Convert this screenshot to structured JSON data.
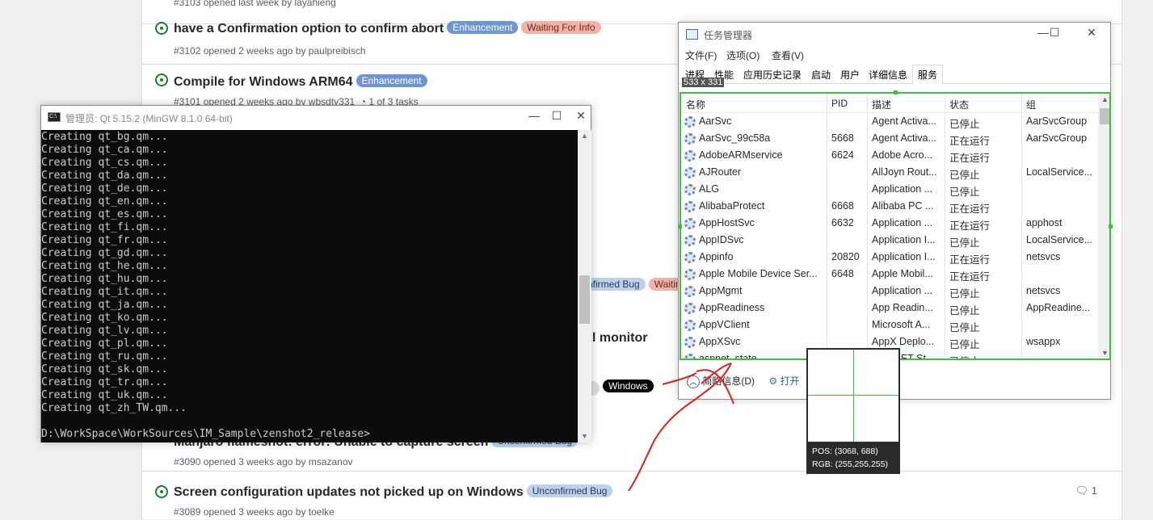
{
  "issues": [
    {
      "title": "",
      "meta": "#3103 opened last week by layahieng",
      "labels": []
    },
    {
      "title": "have a Confirmation option to confirm abort",
      "meta": "#3102 opened 2 weeks ago by paulpreibisch",
      "labels": [
        "Enhancement",
        "Waiting For Info"
      ]
    },
    {
      "title": "Compile for Windows ARM64",
      "meta": "#3101 opened 2 weeks ago by wbsdty331",
      "labels": [
        "Enhancement"
      ],
      "tasks": "1 of 3 tasks"
    },
    {
      "frag_labels": [
        "nfirmed Bug",
        "Waitin"
      ]
    },
    {
      "frag_title": "l monitor"
    },
    {
      "frag_label": "Windows"
    },
    {
      "title": "Manjaro flameshot: error: Unable to capture screen",
      "meta": "#3090 opened 3 weeks ago by msazanov",
      "labels": [
        "Unconfirmed Bug"
      ]
    },
    {
      "title": "Screen configuration updates not picked up on Windows",
      "meta": "#3089 opened 3 weeks ago by toelke",
      "labels": [
        "Unconfirmed Bug"
      ],
      "comments": "1"
    }
  ],
  "console": {
    "title": "管理员: Qt 5.15.2 (MinGW 8.1.0 64-bit)",
    "lines": [
      "Creating qt_bg.qm...",
      "Creating qt_ca.qm...",
      "Creating qt_cs.qm...",
      "Creating qt_da.qm...",
      "Creating qt_de.qm...",
      "Creating qt_en.qm...",
      "Creating qt_es.qm...",
      "Creating qt_fi.qm...",
      "Creating qt_fr.qm...",
      "Creating qt_gd.qm...",
      "Creating qt_he.qm...",
      "Creating qt_hu.qm...",
      "Creating qt_it.qm...",
      "Creating qt_ja.qm...",
      "Creating qt_ko.qm...",
      "Creating qt_lv.qm...",
      "Creating qt_pl.qm...",
      "Creating qt_ru.qm...",
      "Creating qt_sk.qm...",
      "Creating qt_tr.qm...",
      "Creating qt_uk.qm...",
      "Creating qt_zh_TW.qm...",
      "",
      "D:\\WorkSpace\\WorkSources\\IM_Sample\\zenshot2_release>"
    ]
  },
  "taskmgr": {
    "title": "任务管理器",
    "menu": [
      "文件(F)",
      "选项(O)",
      "查看(V)"
    ],
    "tabs": [
      "进程",
      "性能",
      "应用历史记录",
      "启动",
      "用户",
      "详细信息",
      "服务"
    ],
    "active_tab": "服务",
    "selection_size": "533 x 331",
    "columns": [
      "名称",
      "PID",
      "描述",
      "状态",
      "组"
    ],
    "rows": [
      [
        "AarSvc",
        "",
        "Agent Activa...",
        "已停止",
        "AarSvcGroup"
      ],
      [
        "AarSvc_99c58a",
        "5668",
        "Agent Activa...",
        "正在运行",
        "AarSvcGroup"
      ],
      [
        "AdobeARMservice",
        "6624",
        "Adobe Acro...",
        "正在运行",
        ""
      ],
      [
        "AJRouter",
        "",
        "AllJoyn Rout...",
        "已停止",
        "LocalService..."
      ],
      [
        "ALG",
        "",
        "Application ...",
        "已停止",
        ""
      ],
      [
        "AlibabaProtect",
        "6668",
        "Alibaba PC ...",
        "正在运行",
        ""
      ],
      [
        "AppHostSvc",
        "6632",
        "Application ...",
        "正在运行",
        "apphost"
      ],
      [
        "AppIDSvc",
        "",
        "Application I...",
        "已停止",
        "LocalService..."
      ],
      [
        "Appinfo",
        "20820",
        "Application I...",
        "正在运行",
        "netsvcs"
      ],
      [
        "Apple Mobile Device Ser...",
        "6648",
        "Apple Mobil...",
        "正在运行",
        ""
      ],
      [
        "AppMgmt",
        "",
        "Application ...",
        "已停止",
        "netsvcs"
      ],
      [
        "AppReadiness",
        "",
        "App Readin...",
        "已停止",
        "AppReadine..."
      ],
      [
        "AppVClient",
        "",
        "Microsoft A...",
        "已停止",
        ""
      ],
      [
        "AppXSvc",
        "",
        "AppX Deplo...",
        "已停止",
        "wsappx"
      ],
      [
        "aspnet_state",
        "",
        "ASP.NET St...",
        "已停止",
        ""
      ]
    ],
    "footer_less": "简略信息(D)",
    "footer_open": "打开"
  },
  "magnifier": {
    "pos": "POS:  (3068, 688)",
    "rgb": "RGB:  (255,255,255)"
  },
  "colors": {
    "accent_green": "#3fbf3f",
    "arrow_red": "#e02020"
  }
}
